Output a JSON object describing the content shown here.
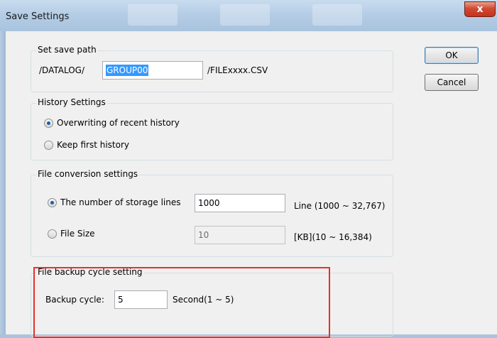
{
  "window": {
    "title": "Save Settings",
    "close_symbol": "x"
  },
  "buttons": {
    "ok": "OK",
    "cancel": "Cancel"
  },
  "save_path": {
    "group_label": "Set save path",
    "prefix": "/DATALOG/",
    "folder_value": "GROUP00",
    "suffix": "/FILExxxx.CSV"
  },
  "history": {
    "group_label": "History Settings",
    "options": [
      {
        "label": "Overwriting of recent history",
        "checked": true
      },
      {
        "label": "Keep first history",
        "checked": false
      }
    ]
  },
  "file_conversion": {
    "group_label": "File conversion settings",
    "lines_option": "The number of storage lines",
    "lines_value": "1000",
    "lines_unit": "Line (1000 ~ 32,767)",
    "size_option": "File Size",
    "size_value": "10",
    "size_unit": "[KB](10 ~ 16,384)",
    "selected": "lines"
  },
  "backup": {
    "group_label": "File backup cycle setting",
    "label": "Backup cycle:",
    "value": "5",
    "unit": "Second(1 ~ 5)"
  },
  "colors": {
    "highlight": "#e53030",
    "selection": "#3399ff"
  }
}
